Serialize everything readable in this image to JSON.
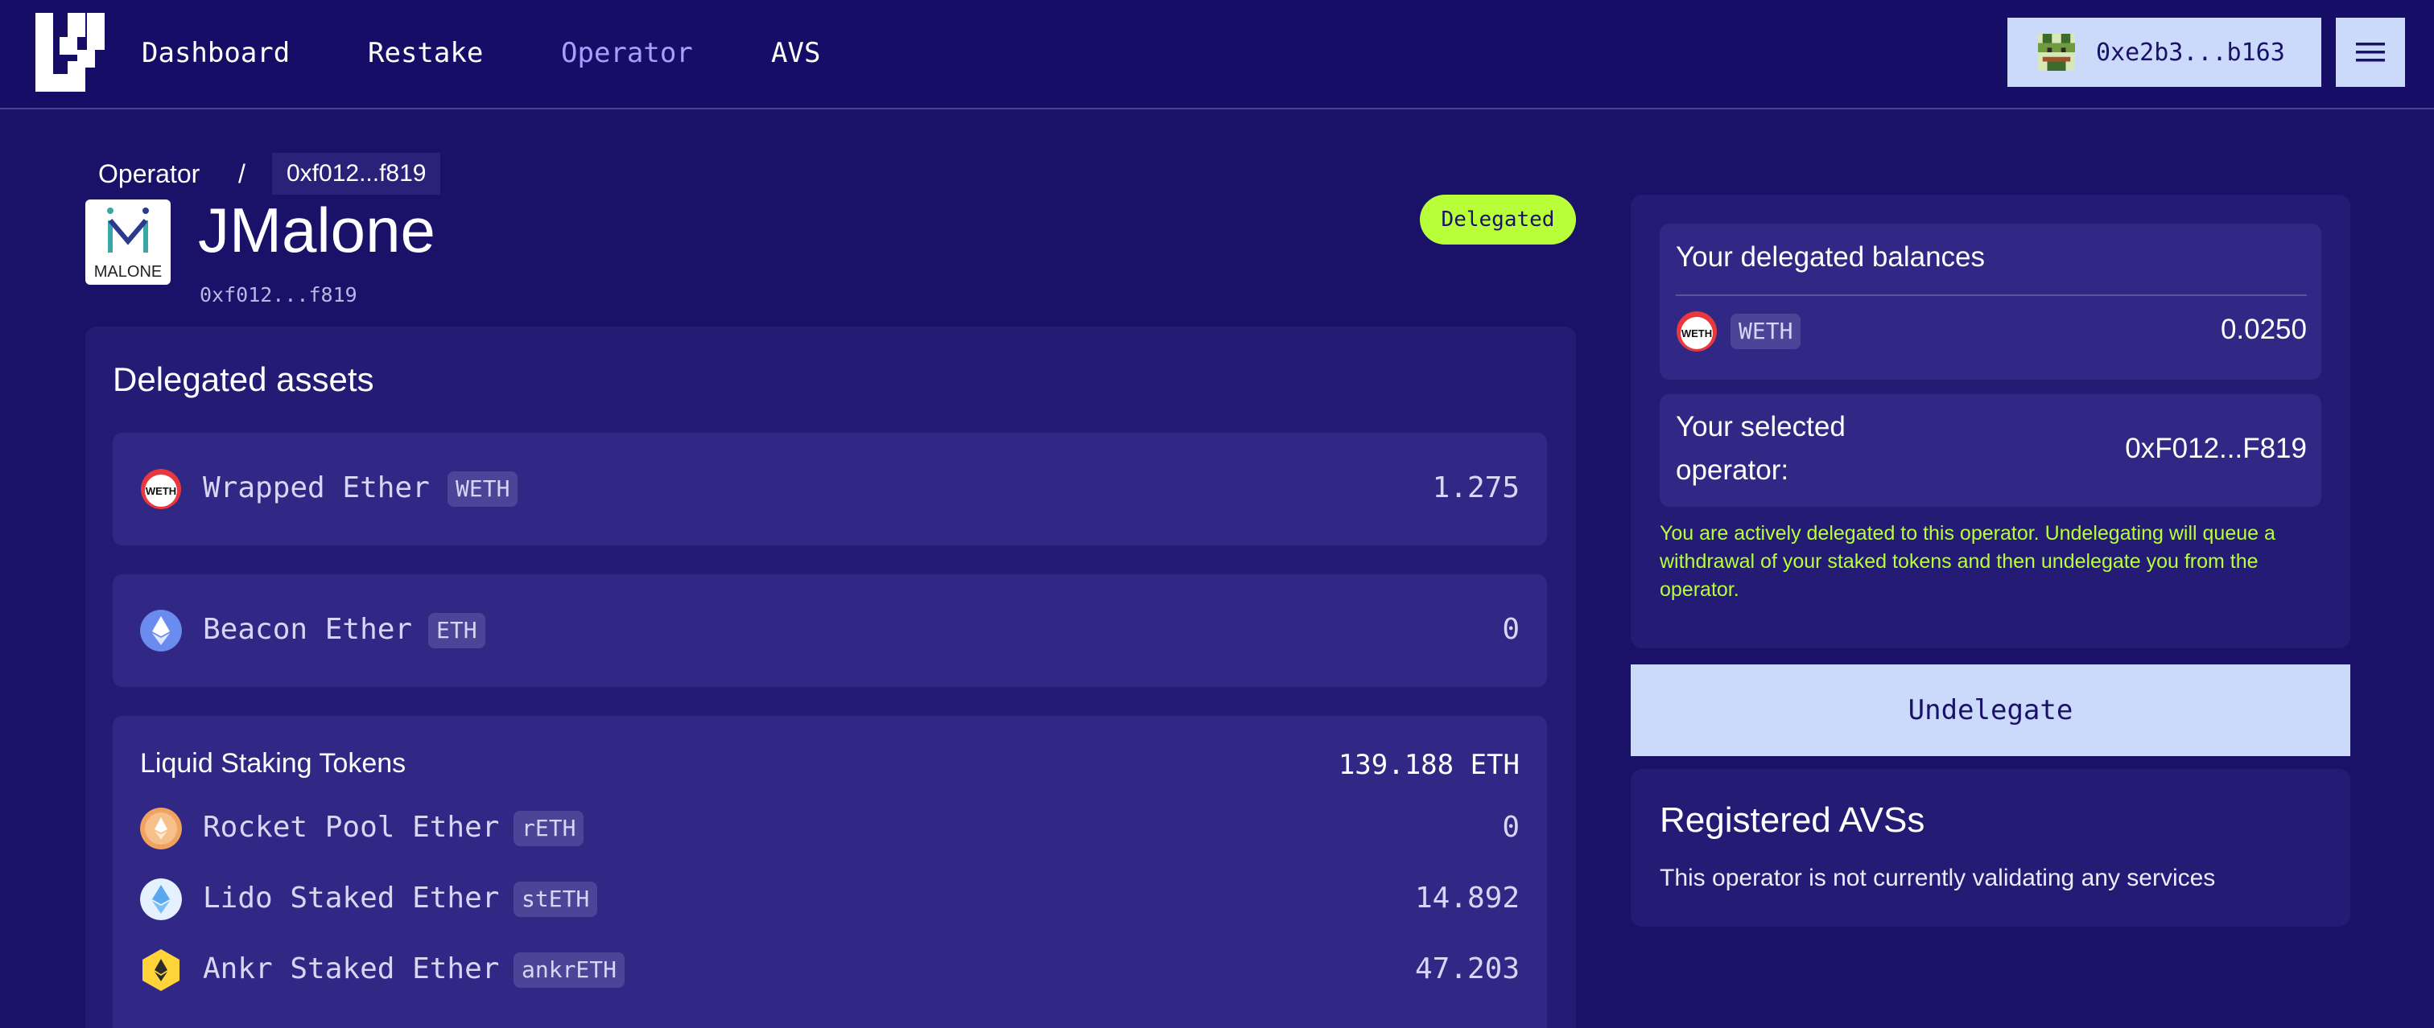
{
  "nav": {
    "links": [
      "Dashboard",
      "Restake",
      "Operator",
      "AVS"
    ],
    "active": "Operator",
    "wallet_address": "0xe2b3...b163"
  },
  "breadcrumb": {
    "root": "Operator",
    "separator": "/",
    "current": "0xf012...f819"
  },
  "operator": {
    "logo_text": "MALONE",
    "name": "JMalone",
    "address": "0xf012...f819",
    "status": "Delegated"
  },
  "assets": {
    "title": "Delegated assets",
    "rows": [
      {
        "name": "Wrapped Ether",
        "symbol": "WETH",
        "amount": "1.275",
        "icon": "weth-icon"
      },
      {
        "name": "Beacon Ether",
        "symbol": "ETH",
        "amount": "0",
        "icon": "eth-icon"
      }
    ],
    "lst": {
      "title": "Liquid Staking Tokens",
      "total": "139.188 ETH",
      "rows": [
        {
          "name": "Rocket Pool Ether",
          "symbol": "rETH",
          "amount": "0",
          "icon": "reth-icon"
        },
        {
          "name": "Lido Staked Ether",
          "symbol": "stETH",
          "amount": "14.892",
          "icon": "steth-icon"
        },
        {
          "name": "Ankr Staked Ether",
          "symbol": "ankrETH",
          "amount": "47.203",
          "icon": "ankreth-icon"
        }
      ]
    }
  },
  "balances": {
    "title": "Your delegated balances",
    "rows": [
      {
        "symbol": "WETH",
        "amount": "0.0250",
        "icon": "weth-icon"
      }
    ],
    "selected_label": "Your selected operator:",
    "selected_address": "0xF012...F819",
    "notice": "You are actively delegated to this operator. Undelegating will queue a withdrawal of your staked tokens and then undelegate you from the operator.",
    "undelegate_label": "Undelegate"
  },
  "avs": {
    "title": "Registered AVSs",
    "text": "This operator is not currently validating any services"
  },
  "colors": {
    "background": "#1a1168",
    "accent_green": "#b8ff3a",
    "button_light": "#cbd9fb",
    "active_link": "#a5a0ff"
  }
}
